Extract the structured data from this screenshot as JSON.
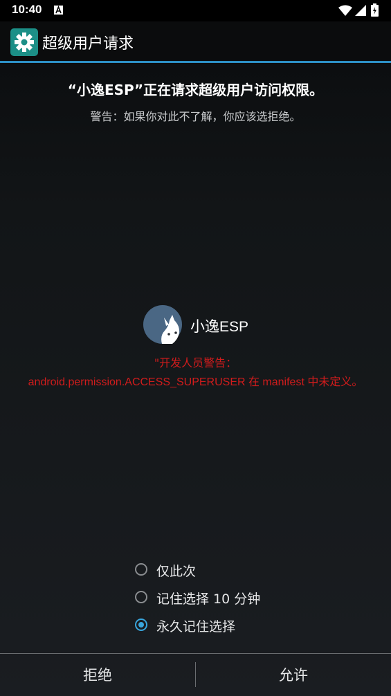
{
  "status_bar": {
    "time": "10:40",
    "notification_icon": "a-icon",
    "wifi_icon": "wifi-icon",
    "signal_icon": "signal-icon",
    "battery_icon": "battery-charging-icon"
  },
  "app_bar": {
    "title": "超级用户请求",
    "icon": "gear-icon",
    "accent_color": "#2d90c6",
    "icon_bg_color": "#1c8f87"
  },
  "request": {
    "title": "“小逸ESP”正在请求超级用户访问权限。",
    "warning": "警告：如果你对此不了解，你应该选拒绝。"
  },
  "requesting_app": {
    "name": "小逸ESP",
    "avatar_icon": "app-avatar-icon",
    "dev_warning_line1": "\"开发人员警告：",
    "dev_warning_line2": "android.permission.ACCESS_SUPERUSER 在 manifest 中未定义。",
    "warning_color": "#d11c1c"
  },
  "options": [
    {
      "label": "仅此次",
      "checked": false
    },
    {
      "label": "记住选择 10 分钟",
      "checked": false
    },
    {
      "label": "永久记住选择",
      "checked": true
    }
  ],
  "buttons": {
    "deny": "拒绝",
    "allow": "允许"
  }
}
